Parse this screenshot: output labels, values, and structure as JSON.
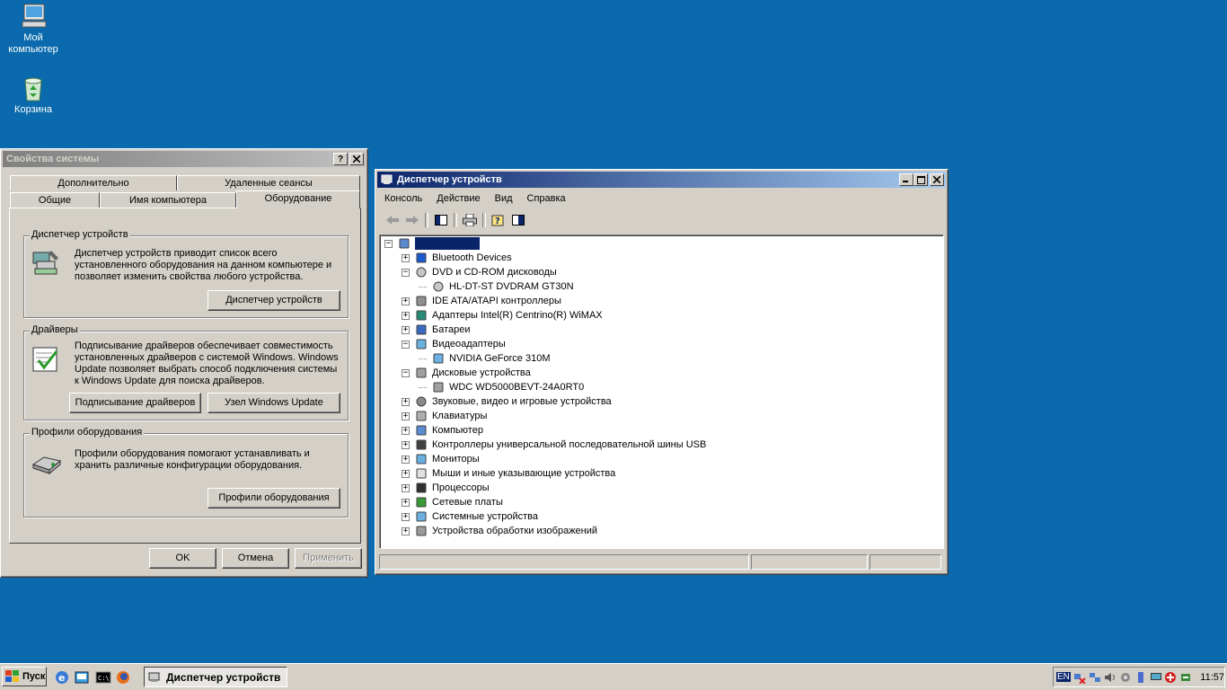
{
  "desktop": {
    "icons": [
      {
        "label": "Мой компьютер",
        "icon": "my-computer-icon"
      },
      {
        "label": "Корзина",
        "icon": "recycle-bin-icon"
      }
    ]
  },
  "sysprops": {
    "title": "Свойства системы",
    "help_btn": "?",
    "close_btn": "✕",
    "tabs_row1": [
      "Дополнительно",
      "Удаленные сеансы"
    ],
    "tabs_row2": [
      "Общие",
      "Имя компьютера",
      "Оборудование"
    ],
    "selected_tab": "Оборудование",
    "groups": {
      "devmgr": {
        "title": "Диспетчер устройств",
        "text": "Диспетчер устройств приводит список всего установленного оборудования на данном компьютере и позволяет изменить свойства любого устройства.",
        "button": "Диспетчер устройств"
      },
      "drivers": {
        "title": "Драйверы",
        "text": "Подписывание драйверов обеспечивает совместимость установленных драйверов с системой Windows. Windows Update позволяет выбрать способ подключения системы к Windows Update для поиска драйверов.",
        "button1": "Подписывание драйверов",
        "button2": "Узел Windows Update"
      },
      "profiles": {
        "title": "Профили оборудования",
        "text": "Профили оборудования помогают устанавливать и хранить различные конфигурации оборудования.",
        "button": "Профили оборудования"
      }
    },
    "footer": {
      "ok": "OK",
      "cancel": "Отмена",
      "apply": "Применить"
    }
  },
  "devmgr": {
    "title": "Диспетчер устройств",
    "menu": [
      "Консоль",
      "Действие",
      "Вид",
      "Справка"
    ],
    "tree": [
      {
        "label": "",
        "level": 0,
        "expander": "−",
        "icon": "computer-icon",
        "selected": true
      },
      {
        "label": "Bluetooth Devices",
        "level": 1,
        "expander": "+",
        "icon": "bluetooth-icon"
      },
      {
        "label": "DVD и CD-ROM дисководы",
        "level": 1,
        "expander": "−",
        "icon": "cdrom-icon"
      },
      {
        "label": "HL-DT-ST DVDRAM GT30N",
        "level": 2,
        "expander": "",
        "icon": "cdrom-icon"
      },
      {
        "label": "IDE ATA/ATAPI контроллеры",
        "level": 1,
        "expander": "+",
        "icon": "ide-icon"
      },
      {
        "label": "Адаптеры Intel(R) Centrino(R) WiMAX",
        "level": 1,
        "expander": "+",
        "icon": "wimax-icon"
      },
      {
        "label": "Батареи",
        "level": 1,
        "expander": "+",
        "icon": "battery-icon"
      },
      {
        "label": "Видеоадаптеры",
        "level": 1,
        "expander": "−",
        "icon": "display-adapter-icon"
      },
      {
        "label": "NVIDIA GeForce 310M",
        "level": 2,
        "expander": "",
        "icon": "display-adapter-icon"
      },
      {
        "label": "Дисковые устройства",
        "level": 1,
        "expander": "−",
        "icon": "disk-icon"
      },
      {
        "label": "WDC WD5000BEVT-24A0RT0",
        "level": 2,
        "expander": "",
        "icon": "disk-icon"
      },
      {
        "label": "Звуковые, видео и игровые устройства",
        "level": 1,
        "expander": "+",
        "icon": "sound-icon"
      },
      {
        "label": "Клавиатуры",
        "level": 1,
        "expander": "+",
        "icon": "keyboard-icon"
      },
      {
        "label": "Компьютер",
        "level": 1,
        "expander": "+",
        "icon": "computer-icon"
      },
      {
        "label": "Контроллеры универсальной последовательной шины USB",
        "level": 1,
        "expander": "+",
        "icon": "usb-icon"
      },
      {
        "label": "Мониторы",
        "level": 1,
        "expander": "+",
        "icon": "monitor-icon"
      },
      {
        "label": "Мыши и иные указывающие устройства",
        "level": 1,
        "expander": "+",
        "icon": "mouse-icon"
      },
      {
        "label": "Процессоры",
        "level": 1,
        "expander": "+",
        "icon": "cpu-icon"
      },
      {
        "label": "Сетевые платы",
        "level": 1,
        "expander": "+",
        "icon": "network-card-icon"
      },
      {
        "label": "Системные устройства",
        "level": 1,
        "expander": "+",
        "icon": "system-device-icon"
      },
      {
        "label": "Устройства обработки изображений",
        "level": 1,
        "expander": "+",
        "icon": "imaging-icon"
      }
    ]
  },
  "taskbar": {
    "start_label": "Пуск",
    "task_label": "Диспетчер устройств",
    "lang": "EN",
    "clock": "11:57"
  },
  "colors": {
    "desktop": "#0a6aad",
    "active_title": "#0a246a",
    "selection": "#0a246a"
  }
}
